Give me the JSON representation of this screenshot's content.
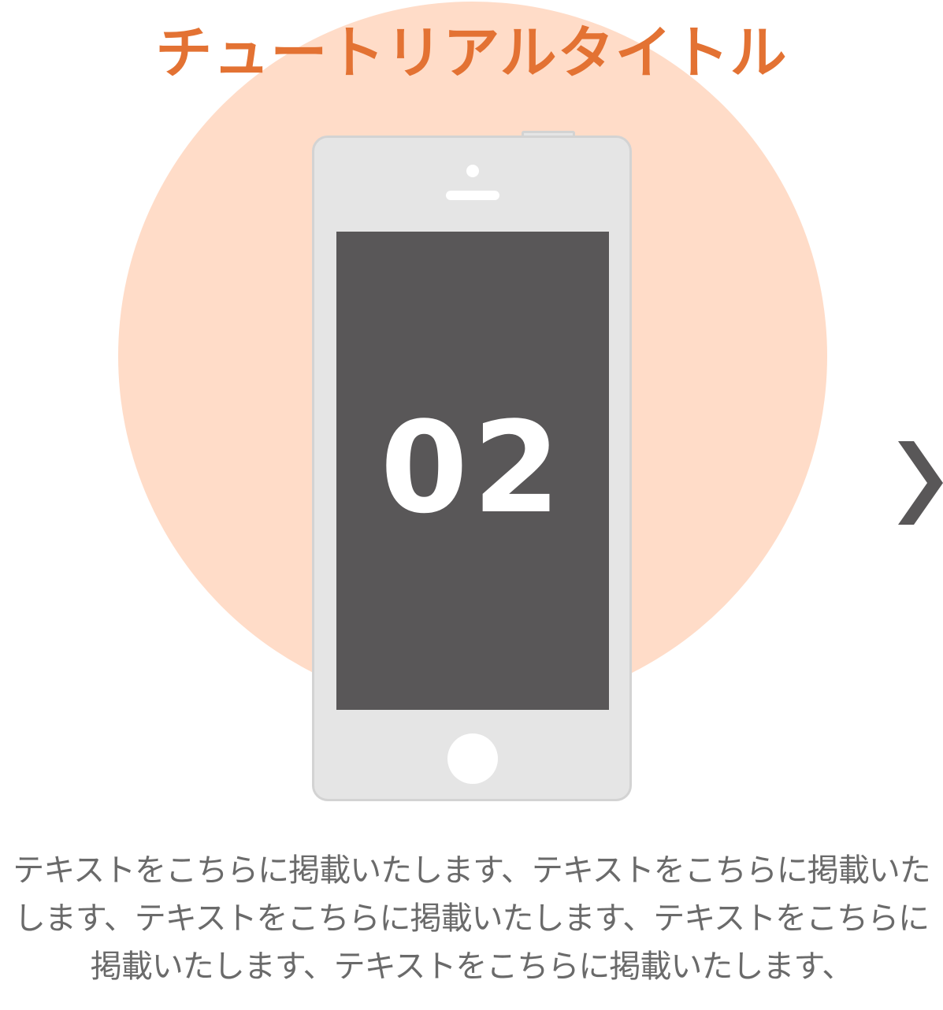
{
  "tutorial": {
    "title": "チュートリアルタイトル",
    "step_number": "02",
    "description_lines": [
      "テキストをこちらに掲載いたします、テキストをこちらに掲載いた",
      "します、テキストをこちらに掲載いたします、テキストをこちらに",
      "掲載いたします、テキストをこちらに掲載いたします、"
    ]
  },
  "navigation": {
    "next_icon": "chevron-right-icon"
  },
  "colors": {
    "title": "#e37233",
    "circle": "#ffdcc8",
    "screen": "#595758",
    "phone_body": "#e5e5e5",
    "arrow": "#595758",
    "text": "#6a6a6a"
  }
}
